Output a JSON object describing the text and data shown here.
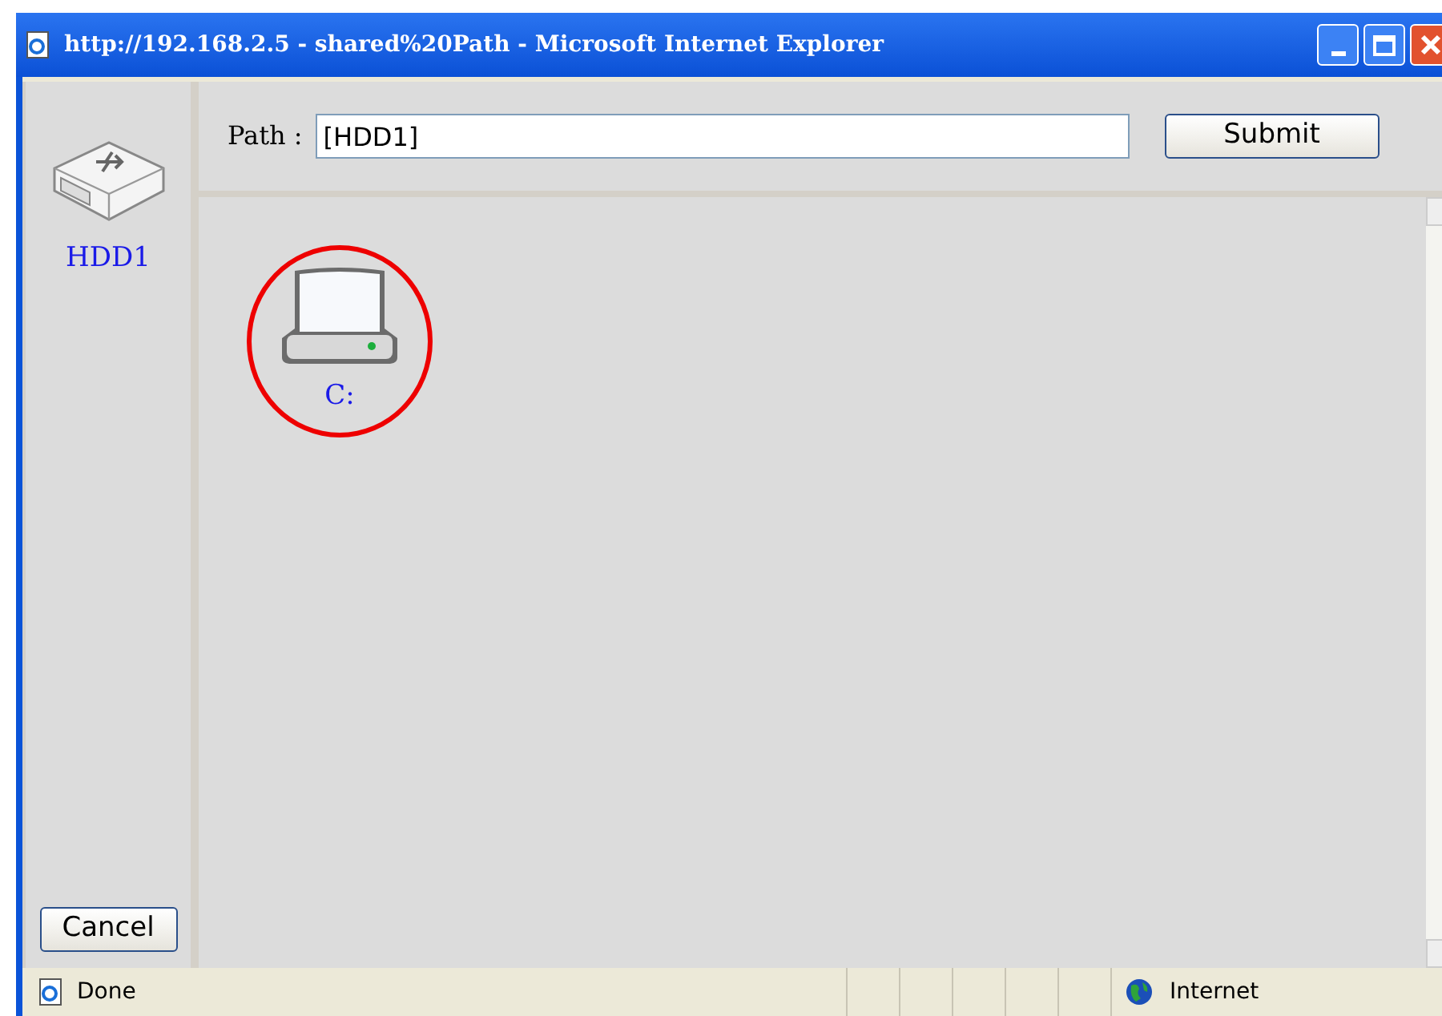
{
  "window": {
    "title": "http://192.168.2.5 - shared%20Path - Microsoft Internet Explorer"
  },
  "sidebar": {
    "drive": {
      "label": "HDD1"
    },
    "cancel_button": "Cancel"
  },
  "path_bar": {
    "label": "Path :",
    "value": "[HDD1]",
    "submit_button": "Submit"
  },
  "files": [
    {
      "label": "C:",
      "circled": true
    }
  ],
  "status_bar": {
    "text": "Done",
    "zone": "Internet"
  }
}
